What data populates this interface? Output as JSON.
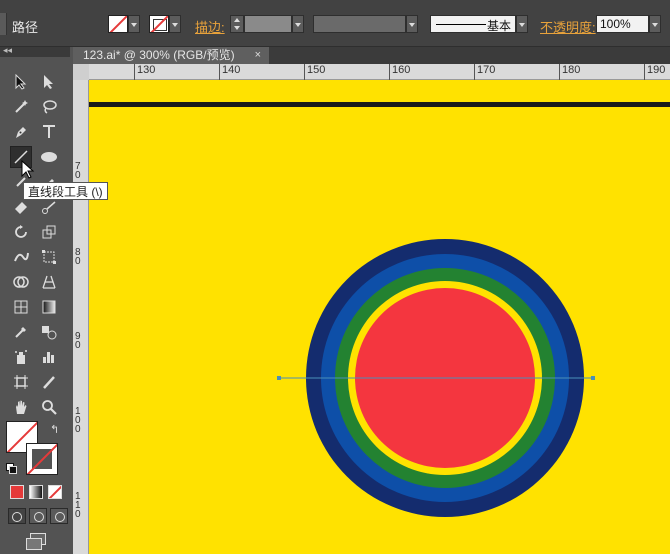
{
  "control_bar": {
    "object_label": "路径",
    "stroke_label": "描边:",
    "stroke_style_label": "基本",
    "opacity_label": "不透明度:",
    "opacity_value": "100%"
  },
  "document_tab": {
    "title": "123.ai* @ 300% (RGB/预览)",
    "close_glyph": "×"
  },
  "ruler": {
    "horizontal": [
      "130",
      "140",
      "150",
      "160",
      "170",
      "180",
      "190"
    ],
    "vertical": [
      "7\n0",
      "8\n0",
      "9\n0",
      "1\n0\n0",
      "1\n1\n0"
    ]
  },
  "tooltip": {
    "text": "直线段工具 (\\)"
  },
  "colors": {
    "canvas_background": "#FFE200",
    "ring_outer": "#142C6E",
    "ring_blue": "#0E4FA8",
    "ring_green": "#238231",
    "ring_yellow": "#FFE200",
    "inner_circle": "#F4363F",
    "guide_line": "#4A8FB8"
  },
  "tools": [
    "selection-tool-icon",
    "direct-selection-tool-icon",
    "magic-wand-tool-icon",
    "lasso-tool-icon",
    "pen-tool-icon",
    "type-tool-icon",
    "line-segment-tool-icon",
    "ellipse-tool-icon",
    "paintbrush-tool-icon",
    "pencil-tool-icon",
    "eraser-tool-icon",
    "scissors-tool-icon",
    "rotate-tool-icon",
    "scale-tool-icon",
    "warp-tool-icon",
    "free-transform-tool-icon",
    "shape-builder-tool-icon",
    "perspective-grid-tool-icon",
    "mesh-tool-icon",
    "gradient-tool-icon",
    "eyedropper-tool-icon",
    "blend-tool-icon",
    "symbol-sprayer-tool-icon",
    "column-graph-tool-icon",
    "artboard-tool-icon",
    "slice-tool-icon",
    "hand-tool-icon",
    "zoom-tool-icon"
  ]
}
